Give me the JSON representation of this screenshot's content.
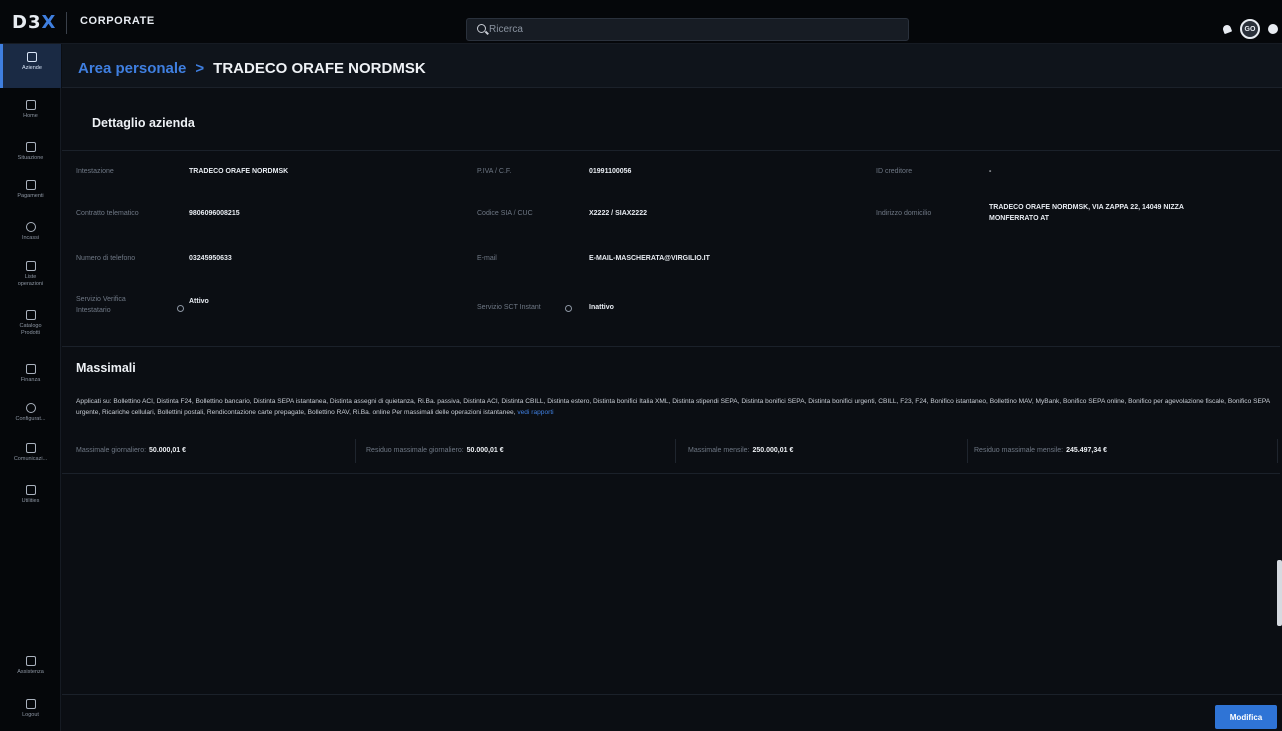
{
  "app": {
    "logo_main": "D3",
    "logo_x": "X",
    "section": "CORPORATE"
  },
  "search": {
    "placeholder": "Ricerca"
  },
  "user": {
    "initials": "GO"
  },
  "sidebar": {
    "items": [
      {
        "label": "Aziende",
        "icon": "building-icon",
        "active": true
      },
      {
        "label": "Home",
        "icon": "home-icon"
      },
      {
        "label": "Situazione",
        "icon": "chart-icon"
      },
      {
        "label": "Pagamenti",
        "icon": "wallet-icon"
      },
      {
        "label": "Incassi",
        "icon": "incoming-icon"
      },
      {
        "label": "Liste",
        "label2": "operazioni",
        "icon": "list-icon"
      },
      {
        "label": "Catalogo",
        "label2": "Prodotti",
        "icon": "grid-icon"
      },
      {
        "label": "Finanza",
        "icon": "finance-icon"
      },
      {
        "label": "Configurat...",
        "icon": "gear-icon"
      },
      {
        "label": "Comunicazi...",
        "icon": "document-icon"
      },
      {
        "label": "Utilities",
        "icon": "tools-icon"
      }
    ],
    "assistenza": "Assistenza",
    "logout": "Logout"
  },
  "breadcrumb": {
    "parent": "Area personale",
    "separator": ">",
    "current": "TRADECO ORAFE NORDMSK"
  },
  "detail": {
    "title": "Dettaglio azienda",
    "fields": {
      "intestazione_label": "Intestazione",
      "intestazione_value": "TRADECO ORAFE NORDMSK",
      "piva_label": "P.IVA / C.F.",
      "piva_value": "01991100056",
      "idcred_label": "ID creditore",
      "idcred_value": "-",
      "contratto_label": "Contratto telematico",
      "contratto_value": "9806096008215",
      "sia_label": "Codice SIA / CUC",
      "sia_value": "X2222 / SIAX2222",
      "indirizzo_label": "Indirizzo domicilio",
      "indirizzo_value_1": "TRADECO ORAFE NORDMSK, VIA ZAPPA 22, 14049 NIZZA",
      "indirizzo_value_2": "MONFERRATO AT",
      "telefono_label": "Numero di telefono",
      "telefono_value": "03245950633",
      "email_label": "E-mail",
      "email_value": "E-MAIL-MASCHERATA@VIRGILIO.IT",
      "verifica_label_1": "Servizio Verifica",
      "verifica_label_2": "Intestatario",
      "verifica_value": "Attivo",
      "sct_label": "Servizio SCT Instant",
      "sct_value": "Inattivo"
    }
  },
  "massimali": {
    "title": "Massimali",
    "applicati_prefix": "Applicati su:",
    "applicati_list": "Bollettino ACI, Distinta F24, Bollettino bancario, Distinta SEPA istantanea, Distinta assegni di quietanza, Ri.Ba. passiva, Distinta ACI, Distinta CBILL, Distinta estero, Distinta bonifici Italia XML, Distinta stipendi SEPA, Distinta bonifici SEPA, Distinta bonifici urgenti, CBILL, F23, F24, Bonifico istantaneo, Bollettino MAV, MyBank, Bonifico SEPA online, Bonifico per agevolazione fiscale, Bonifico SEPA urgente, Ricariche cellulari, Bollettini postali, Rendicontazione carte prepagate, Bollettino RAV, Ri.Ba. online",
    "note": "Per massimali delle operazioni istantanee,",
    "link": "vedi rapporti",
    "values": [
      {
        "label": "Massimale giornaliero:",
        "value": "50.000,01 €"
      },
      {
        "label": "Residuo massimale giornaliero:",
        "value": "50.000,01 €"
      },
      {
        "label": "Massimale mensile:",
        "value": "250.000,01 €"
      },
      {
        "label": "Residuo massimale mensile:",
        "value": "245.497,34 €"
      }
    ]
  },
  "actions": {
    "modifica": "Modifica"
  },
  "colors": {
    "accent": "#3f7fe0",
    "background": "#0b0e13",
    "button": "#2f74d6"
  }
}
